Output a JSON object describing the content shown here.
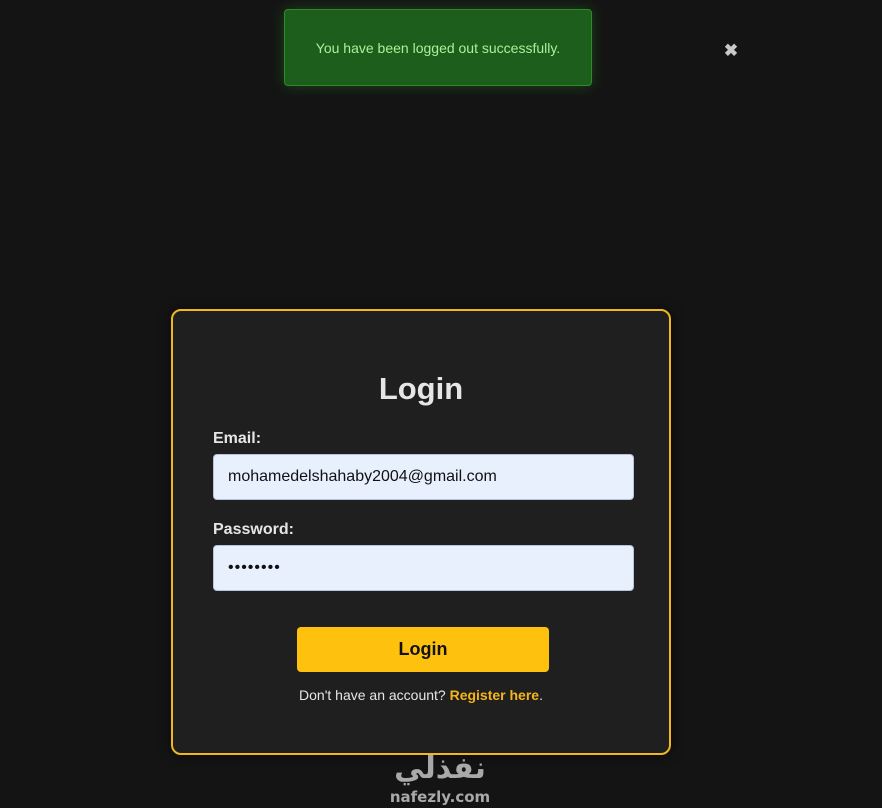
{
  "toast": {
    "message": "You have been logged out successfully.",
    "close_icon": "close-icon"
  },
  "login": {
    "title": "Login",
    "email_label": "Email:",
    "email_value": "mohamedelshahaby2004@gmail.com",
    "password_label": "Password:",
    "password_value": "••••••••",
    "submit_label": "Login",
    "register_prompt": "Don't have an account?",
    "register_link": "Register here",
    "register_suffix": "."
  },
  "watermark": {
    "logo_arabic": "نفذلي",
    "logo_domain": "nafezly.com"
  },
  "colors": {
    "accent": "#fec10e",
    "card_border": "#f0b81c",
    "toast_bg": "#1e5e1c",
    "toast_text": "#a8f09a",
    "background": "#141414"
  }
}
